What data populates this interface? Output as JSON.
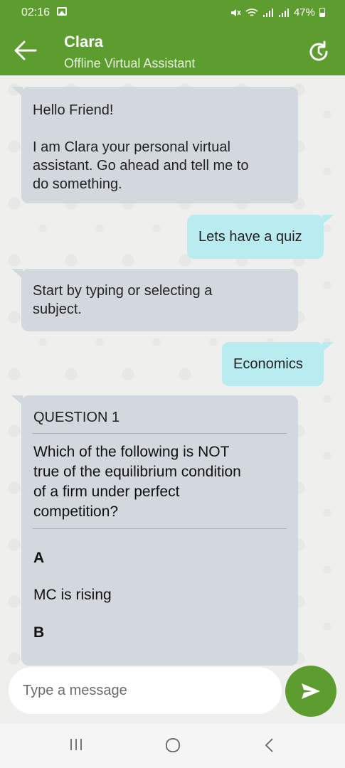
{
  "status_bar": {
    "time": "02:16",
    "battery": "47%"
  },
  "header": {
    "title": "Clara",
    "subtitle": "Offline Virtual Assistant"
  },
  "messages": [
    {
      "sender": "bot",
      "lines": [
        "Hello Friend!",
        "",
        "I am Clara your personal virtual",
        "assistant. Go ahead and tell me to",
        "do something."
      ]
    },
    {
      "sender": "user",
      "text": "Lets have a quiz"
    },
    {
      "sender": "bot",
      "lines": [
        "Start by typing or selecting a",
        "subject."
      ]
    },
    {
      "sender": "user",
      "text": "Economics"
    }
  ],
  "quiz": {
    "label": "QUESTION 1",
    "question_lines": [
      "Which of the following is NOT",
      "true of the equilibrium condition",
      "of a firm under perfect",
      "competition?"
    ],
    "options": [
      {
        "letter": "A",
        "text": "MC is rising"
      },
      {
        "letter": "B",
        "text": ""
      }
    ]
  },
  "composer": {
    "placeholder": "Type a message"
  },
  "colors": {
    "brand": "#5d9c2f",
    "bot_bubble": "#d3d8de",
    "user_bubble": "#b8ecf0"
  },
  "icons": {
    "back": "arrow-left-icon",
    "refresh": "refresh-icon",
    "send": "send-icon",
    "recents": "recents-icon",
    "home": "home-icon",
    "nav_back": "nav-back-icon"
  }
}
